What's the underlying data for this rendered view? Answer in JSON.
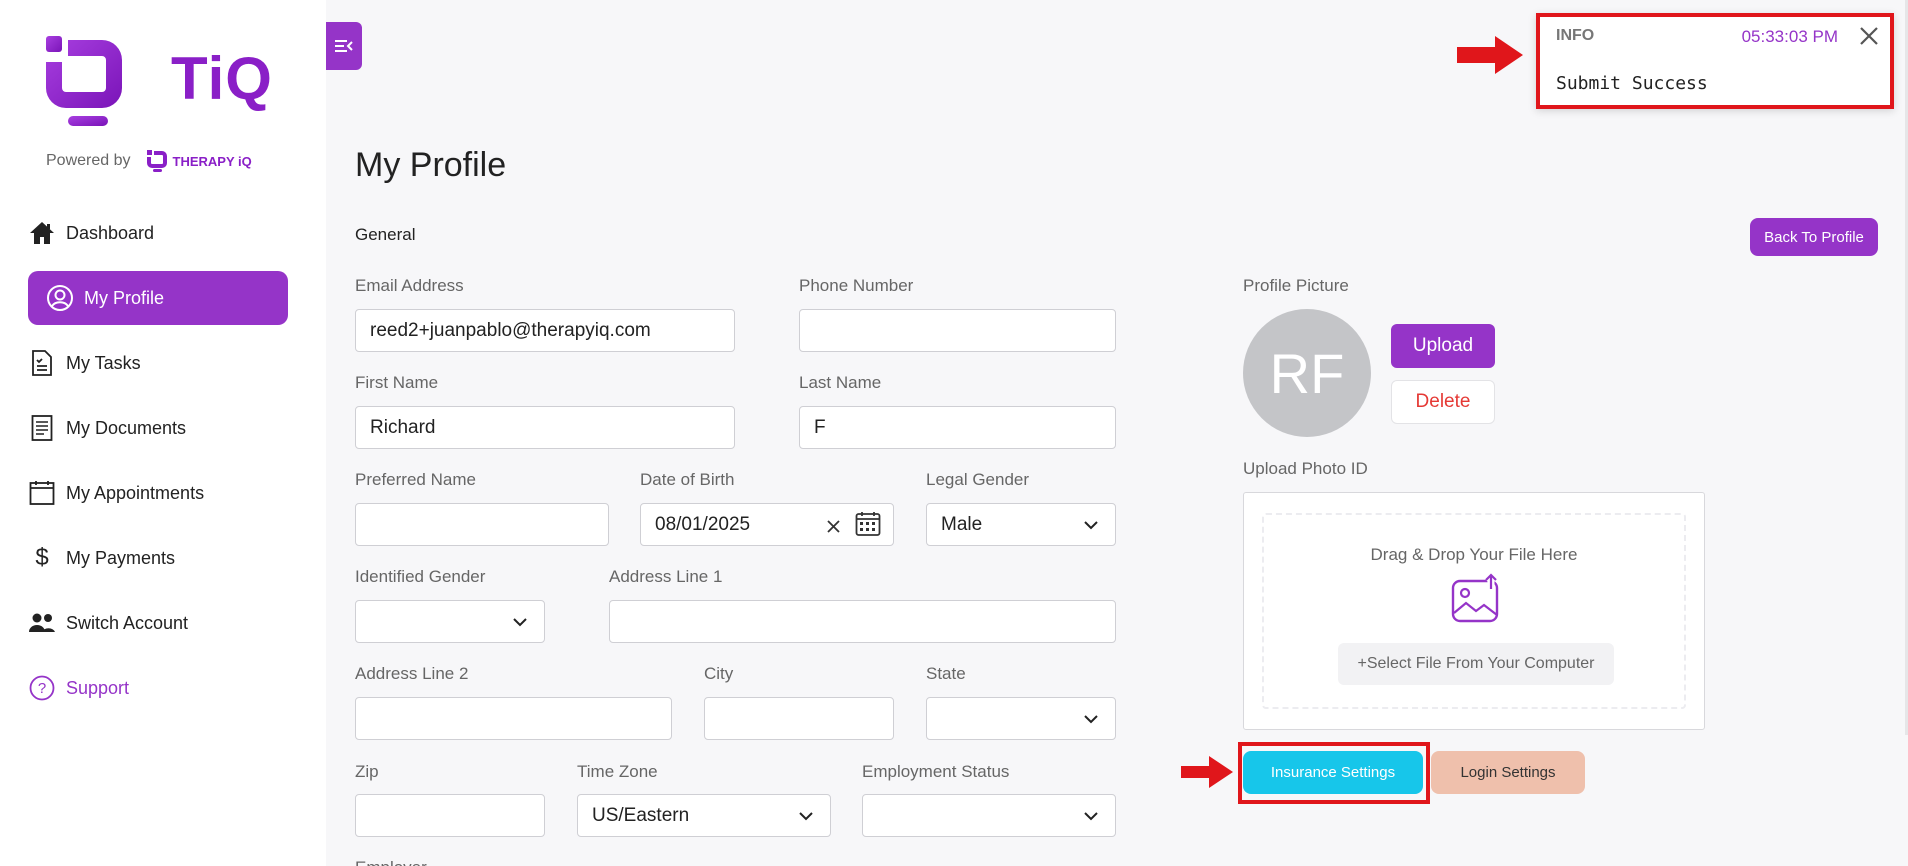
{
  "app": {
    "logo_text": "TiQ",
    "powered_by": "Powered by",
    "brand_name": "THERAPY iQ"
  },
  "sidebar": {
    "items": [
      {
        "label": "Dashboard",
        "icon": "home-icon"
      },
      {
        "label": "My Profile",
        "icon": "user-circle-icon",
        "active": true
      },
      {
        "label": "My Tasks",
        "icon": "task-icon"
      },
      {
        "label": "My Documents",
        "icon": "document-icon"
      },
      {
        "label": "My Appointments",
        "icon": "calendar-icon"
      },
      {
        "label": "My Payments",
        "icon": "dollar-icon"
      },
      {
        "label": "Switch Account",
        "icon": "users-icon"
      },
      {
        "label": "Support",
        "icon": "help-icon"
      }
    ]
  },
  "toast": {
    "type": "INFO",
    "time": "05:33:03 PM",
    "message": "Submit Success"
  },
  "page": {
    "title": "My Profile",
    "section": "General",
    "back_button": "Back To Profile"
  },
  "form": {
    "email": {
      "label": "Email Address",
      "value": "reed2+juanpablo@therapyiq.com"
    },
    "phone": {
      "label": "Phone Number",
      "value": ""
    },
    "first_name": {
      "label": "First Name",
      "value": "Richard"
    },
    "last_name": {
      "label": "Last Name",
      "value": "F"
    },
    "preferred_name": {
      "label": "Preferred Name",
      "value": ""
    },
    "dob": {
      "label": "Date of Birth",
      "value": "08/01/2025"
    },
    "legal_gender": {
      "label": "Legal Gender",
      "value": "Male"
    },
    "identified_gender": {
      "label": "Identified Gender",
      "value": ""
    },
    "address1": {
      "label": "Address Line 1",
      "value": ""
    },
    "address2": {
      "label": "Address Line 2",
      "value": ""
    },
    "city": {
      "label": "City",
      "value": ""
    },
    "state": {
      "label": "State",
      "value": ""
    },
    "zip": {
      "label": "Zip",
      "value": ""
    },
    "time_zone": {
      "label": "Time Zone",
      "value": "US/Eastern"
    },
    "employment": {
      "label": "Employment Status",
      "value": ""
    },
    "partial_label": "Employer"
  },
  "profile_picture": {
    "label": "Profile Picture",
    "initials": "RF",
    "upload_label": "Upload",
    "delete_label": "Delete"
  },
  "photo_id": {
    "label": "Upload Photo ID",
    "drop_text": "Drag & Drop Your File Here",
    "select_text": "+Select File From Your Computer"
  },
  "settings": {
    "insurance": "Insurance Settings",
    "login": "Login Settings"
  },
  "colors": {
    "brand_purple": "#9534c8",
    "insurance_button": "#17c6ea",
    "login_button": "#efc0ac",
    "highlight_red": "#e0161b"
  }
}
